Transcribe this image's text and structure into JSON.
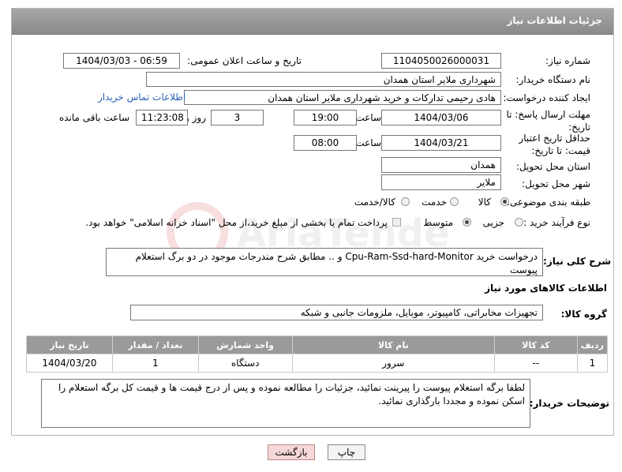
{
  "header": {
    "title": "جزئیات اطلاعات نیاز"
  },
  "form": {
    "need_number_label": "شماره نیاز:",
    "need_number": "1104050026000031",
    "announce_label": "تاریخ و ساعت اعلان عمومی:",
    "announce_value": "1404/03/03 - 06:59",
    "buyer_org_label": "نام دستگاه خریدار:",
    "buyer_org": "شهرداری ملایر استان همدان",
    "creator_label": "ایجاد کننده درخواست:",
    "creator": "هادی رحیمی تدارکات و خرید شهرداری ملایر استان همدان",
    "contact_link": "اطلاعات تماس خریدار",
    "deadline_label": "مهلت ارسال پاسخ: تا تاریخ:",
    "deadline_date": "1404/03/06",
    "time_label": "ساعت",
    "deadline_time": "19:00",
    "days_value": "3",
    "days_label": "روز و",
    "remaining_time": "11:23:08",
    "remaining_label": "ساعت باقی مانده",
    "min_validity_label": "حداقل تاریخ اعتبار قیمت: تا تاریخ:",
    "validity_date": "1404/03/21",
    "validity_time": "08:00",
    "province_label": "استان محل تحویل:",
    "province": "همدان",
    "city_label": "شهر محل تحویل:",
    "city": "ملایر",
    "category_label": "طبقه بندی موضوعی:",
    "category_options": [
      "کالا",
      "خدمت",
      "کالا/خدمت"
    ],
    "process_label": "نوع فرآیند خرید :",
    "process_options": [
      "جزیی",
      "متوسط"
    ],
    "payment_note": "پرداخت تمام یا بخشی از مبلغ خرید،از محل \"اسناد خزانه اسلامی\" خواهد بود.",
    "summary_label": "شرح کلی نیاز:",
    "summary": "درخواست خرید Cpu-Ram-Ssd-hard-Monitor و .. مطابق شرح مندرجات موجود در دو برگ استعلام پیوست"
  },
  "goods": {
    "section_title": "اطلاعات کالاهای مورد نیاز",
    "group_label": "گروه کالا:",
    "group_value": "تجهیزات مخابراتی، کامپیوتر، موبایل، ملزومات جانبی و شبکه",
    "columns": [
      "ردیف",
      "کد کالا",
      "نام کالا",
      "واحد شمارش",
      "تعداد / مقدار",
      "تاریخ نیاز"
    ],
    "rows": [
      [
        "1",
        "--",
        "سرور",
        "دستگاه",
        "1",
        "1404/03/20"
      ]
    ]
  },
  "buyer_notes": {
    "label": "توضیحات خریدار:",
    "text": "لطفا برگه استعلام پیوست را پیرینت نمائید، جزئیات را مطالعه نموده و پس از درج قیمت ها و قیمت کل برگه استعلام را اسکن نموده و مجددا بارگذاری نمائید."
  },
  "buttons": {
    "print": "چاپ",
    "back": "بازگشت"
  },
  "watermark": {
    "text": "AriaTender.net"
  }
}
